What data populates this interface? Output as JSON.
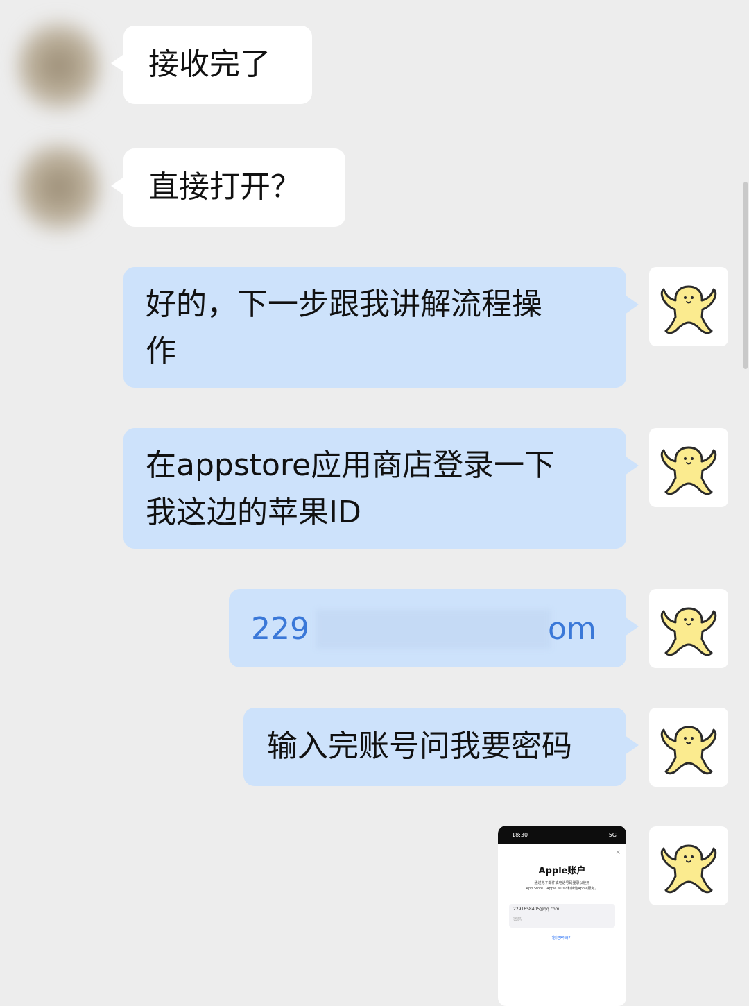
{
  "messages": [
    {
      "side": "left",
      "text": "接收完了"
    },
    {
      "side": "left",
      "text": "直接打开？"
    },
    {
      "side": "right",
      "line1": "好的，下一步跟我讲解流程操",
      "line2": "作"
    },
    {
      "side": "right",
      "line1": "在appstore应用商店登录一下",
      "line2": "我这边的苹果ID"
    },
    {
      "side": "right",
      "email_start": "229",
      "email_end": "om"
    },
    {
      "side": "right",
      "text": "输入完账号问我要密码"
    }
  ],
  "screenshot": {
    "time": "18:30",
    "signal": "5G",
    "title": "Apple账户",
    "subtitle_line1": "通过电子邮件或电话号码登录以使用",
    "subtitle_line2": "App Store、Apple Music和其他Apple服务。",
    "account_value": "2291658405@qq.com",
    "password_placeholder": "密码",
    "forgot_link": "忘记密码？",
    "close": "×"
  },
  "colors": {
    "background": "#ededed",
    "left_bubble": "#ffffff",
    "right_bubble": "#cde2fb",
    "link_text": "#3a78d8",
    "avatar_yellow": "#fbeb8f"
  },
  "icons": [
    "yellow-mascot-avatar-icon",
    "blurred-contact-avatar"
  ]
}
